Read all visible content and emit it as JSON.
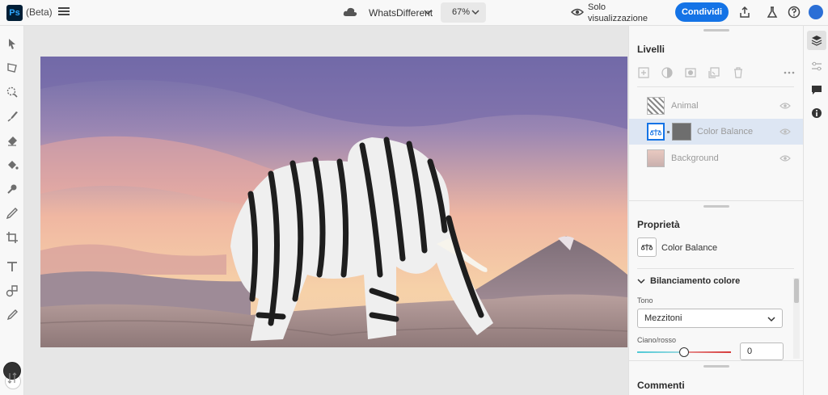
{
  "app": {
    "logo": "Ps",
    "badge": "(Beta)"
  },
  "document": {
    "name": "WhatsDifferent"
  },
  "zoom": {
    "value": "67%"
  },
  "view_mode": {
    "line1": "Solo",
    "line2": "visualizzazione"
  },
  "share": {
    "label": "Condividi"
  },
  "layers_panel": {
    "title": "Livelli",
    "layers": [
      {
        "name": "Animal",
        "selected": false
      },
      {
        "name": "Color Balance",
        "selected": true
      },
      {
        "name": "Background",
        "selected": false
      }
    ]
  },
  "properties_panel": {
    "title": "Proprietà",
    "adjustment_name": "Color Balance",
    "section_title": "Bilanciamento colore",
    "tone_label": "Tono",
    "tone_value": "Mezzitoni",
    "cyan_red_label": "Ciano/rosso",
    "cyan_red_value": "0"
  },
  "comments_panel": {
    "title": "Commenti"
  },
  "colors": {
    "accent": "#1473e6",
    "selected_row": "#dde6f3"
  }
}
